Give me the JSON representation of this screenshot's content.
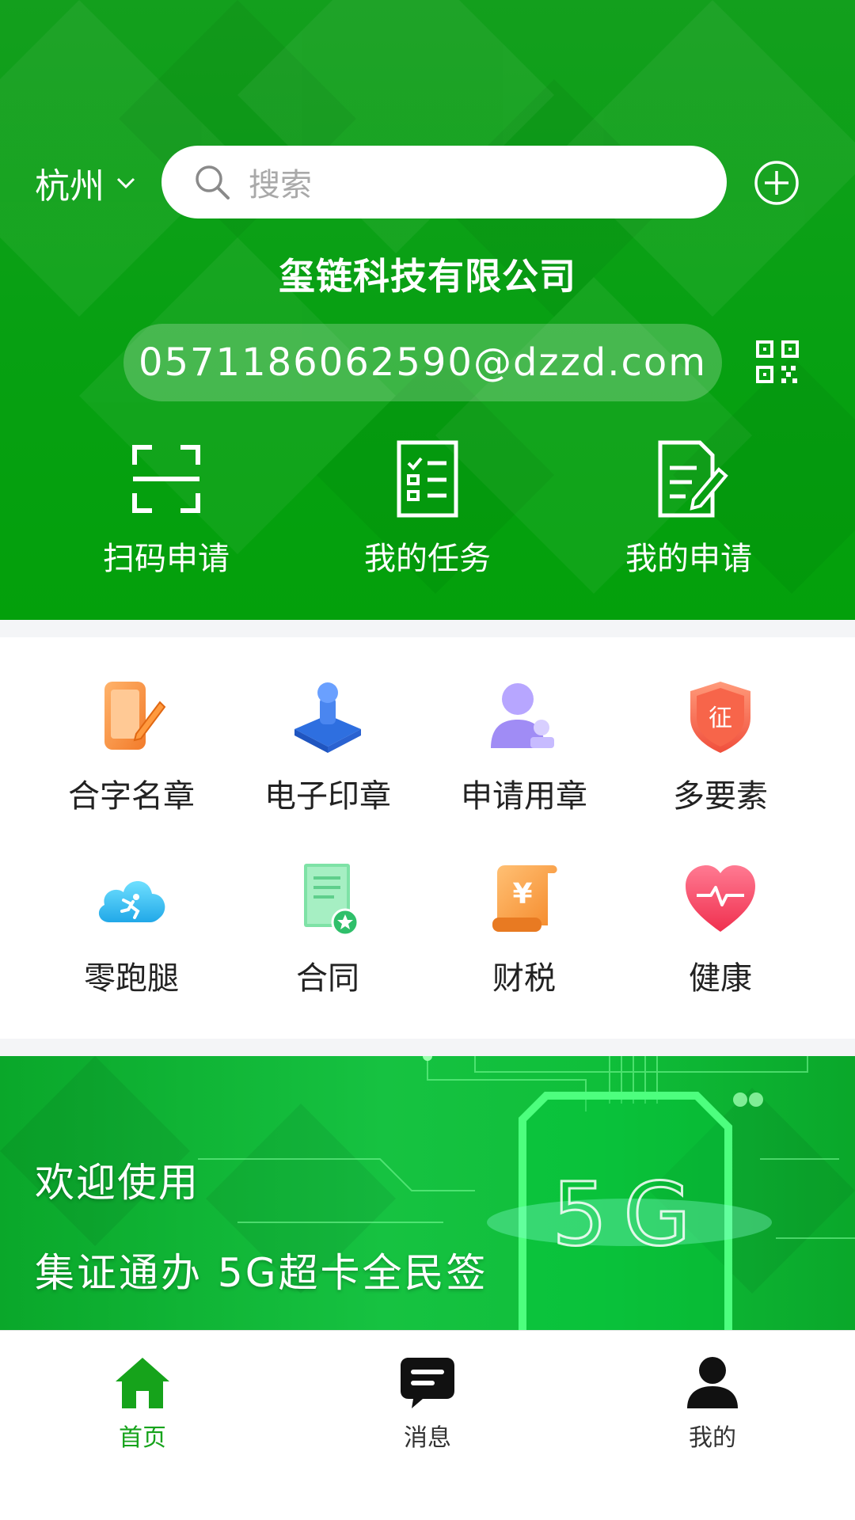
{
  "header": {
    "city": "杭州",
    "search_placeholder": "搜索",
    "company_name": "玺链科技有限公司",
    "email": "0571186062590@dzzd.com",
    "quick_actions": [
      {
        "label": "扫码申请",
        "icon": "scan-icon"
      },
      {
        "label": "我的任务",
        "icon": "task-checklist-icon"
      },
      {
        "label": "我的申请",
        "icon": "application-edit-icon"
      }
    ]
  },
  "services": [
    {
      "label": "合字名章",
      "icon": "signature-seal-icon"
    },
    {
      "label": "电子印章",
      "icon": "electronic-stamp-icon"
    },
    {
      "label": "申请用章",
      "icon": "apply-seal-user-icon"
    },
    {
      "label": "多要素",
      "icon": "multi-factor-shield-icon",
      "badge": "征"
    },
    {
      "label": "零跑腿",
      "icon": "zero-errand-cloud-icon"
    },
    {
      "label": "合同",
      "icon": "contract-document-icon"
    },
    {
      "label": "财税",
      "icon": "finance-tax-scroll-icon",
      "badge": "¥"
    },
    {
      "label": "健康",
      "icon": "health-heart-icon"
    }
  ],
  "banner": {
    "line1": "欢迎使用",
    "line2": "集证通办 5G超卡全民签",
    "graphic_text": "5G"
  },
  "tabbar": [
    {
      "label": "首页",
      "icon": "home-icon",
      "active": true
    },
    {
      "label": "消息",
      "icon": "message-icon",
      "active": false
    },
    {
      "label": "我的",
      "icon": "profile-icon",
      "active": false
    }
  ],
  "colors": {
    "brand_green": "#08a012",
    "active_tab": "#16a31b"
  }
}
